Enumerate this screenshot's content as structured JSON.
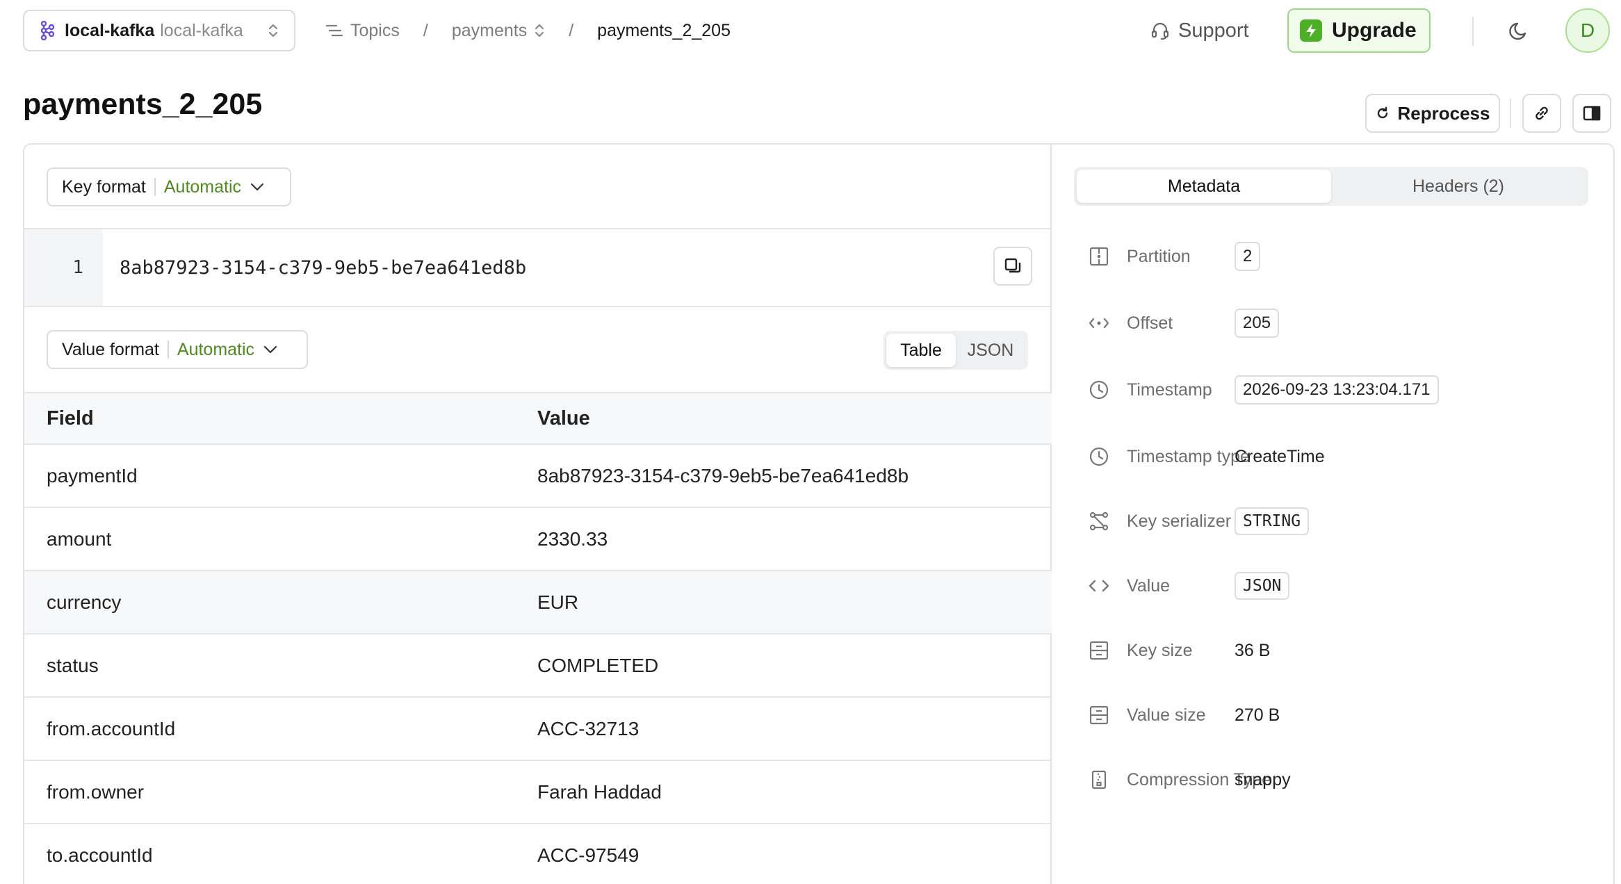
{
  "topbar": {
    "cluster_name": "local-kafka",
    "cluster_env": "local-kafka",
    "breadcrumbs": {
      "topics": "Topics",
      "topic": "payments",
      "current": "payments_2_205",
      "separator": "/"
    },
    "support_label": "Support",
    "upgrade_label": "Upgrade",
    "avatar_initial": "D"
  },
  "page": {
    "title": "payments_2_205",
    "reprocess_label": "Reprocess"
  },
  "key": {
    "format_label": "Key format",
    "format_value": "Automatic",
    "line_number": "1",
    "value": "8ab87923-3154-c379-9eb5-be7ea641ed8b"
  },
  "value": {
    "format_label": "Value format",
    "format_value": "Automatic",
    "view_table": "Table",
    "view_json": "JSON",
    "headers": {
      "field": "Field",
      "value": "Value"
    },
    "rows": [
      {
        "field": "paymentId",
        "value": "8ab87923-3154-c379-9eb5-be7ea641ed8b"
      },
      {
        "field": "amount",
        "value": "2330.33"
      },
      {
        "field": "currency",
        "value": "EUR"
      },
      {
        "field": "status",
        "value": "COMPLETED"
      },
      {
        "field": "from.accountId",
        "value": "ACC-32713"
      },
      {
        "field": "from.owner",
        "value": "Farah Haddad"
      },
      {
        "field": "to.accountId",
        "value": "ACC-97549"
      }
    ]
  },
  "metadata": {
    "tab_metadata": "Metadata",
    "tab_headers": "Headers (2)",
    "items": [
      {
        "label": "Partition",
        "value": "2"
      },
      {
        "label": "Offset",
        "value": "205"
      },
      {
        "label": "Timestamp",
        "value": "2026-09-23 13:23:04.171"
      },
      {
        "label": "Timestamp type",
        "value": "CreateTime"
      },
      {
        "label": "Key serializer",
        "value": "STRING"
      },
      {
        "label": "Value",
        "value": "JSON"
      },
      {
        "label": "Key size",
        "value": "36 B"
      },
      {
        "label": "Value size",
        "value": "270 B"
      },
      {
        "label": "Compression Type",
        "value": "snappy"
      }
    ]
  },
  "colors": {
    "accent_green": "#4f8a1f",
    "upgrade_bg": "#f1fbec",
    "upgrade_border": "#9bd88a",
    "cluster_icon": "#6b4fd6"
  }
}
